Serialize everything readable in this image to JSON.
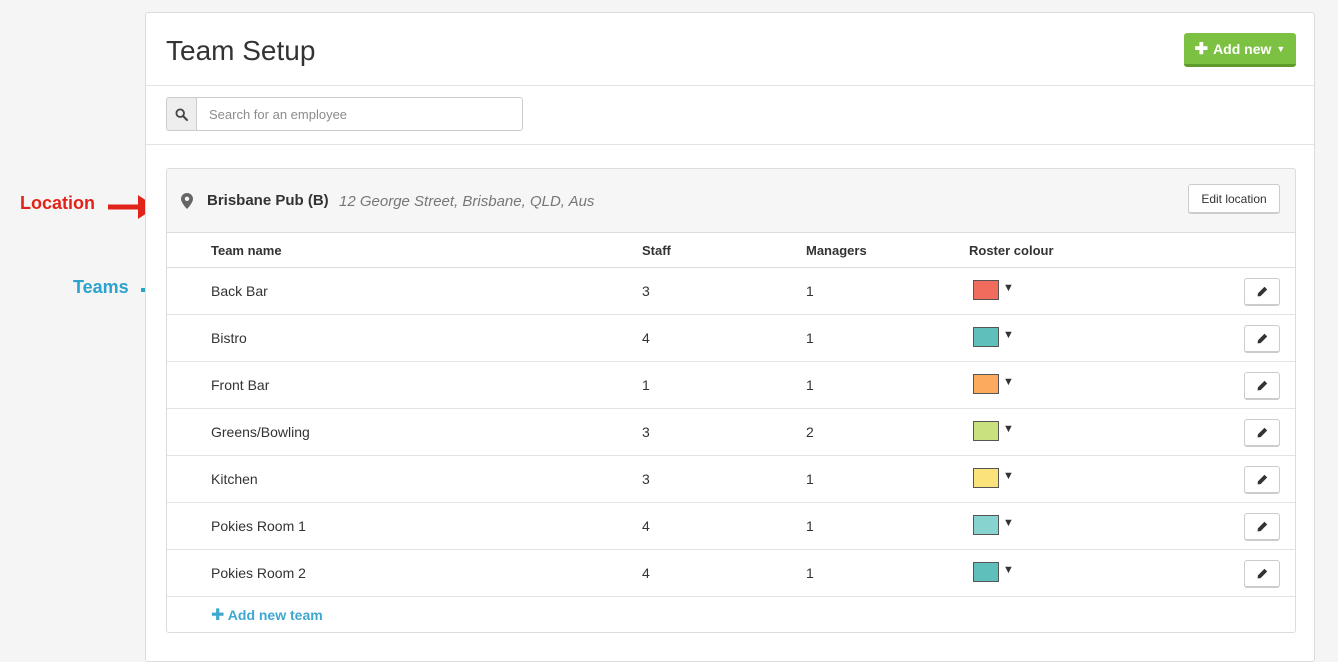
{
  "page": {
    "title": "Team Setup",
    "add_new_label": "Add new",
    "search_placeholder": "Search for an employee"
  },
  "location": {
    "name": "Brisbane Pub (B)",
    "address": "12 George Street, Brisbane, QLD, Aus",
    "edit_label": "Edit location"
  },
  "columns": {
    "team_name": "Team name",
    "staff": "Staff",
    "managers": "Managers",
    "roster_colour": "Roster colour"
  },
  "teams": [
    {
      "name": "Back Bar",
      "staff": "3",
      "managers": "1",
      "colour": "#f26c5d"
    },
    {
      "name": "Bistro",
      "staff": "4",
      "managers": "1",
      "colour": "#5fbfbb"
    },
    {
      "name": "Front Bar",
      "staff": "1",
      "managers": "1",
      "colour": "#fbaa5e"
    },
    {
      "name": "Greens/Bowling",
      "staff": "3",
      "managers": "2",
      "colour": "#c9e27f"
    },
    {
      "name": "Kitchen",
      "staff": "3",
      "managers": "1",
      "colour": "#fbe27a"
    },
    {
      "name": "Pokies Room 1",
      "staff": "4",
      "managers": "1",
      "colour": "#86d3cf"
    },
    {
      "name": "Pokies Room 2",
      "staff": "4",
      "managers": "1",
      "colour": "#5fbfbb"
    }
  ],
  "add_team_label": "Add new team",
  "annotations": {
    "location": "Location",
    "teams": "Teams",
    "location_color": "#e2231a",
    "teams_color": "#2ba3cc"
  },
  "icons": {
    "search": "search-icon",
    "location": "map-pin-icon",
    "edit": "pencil-icon",
    "plus": "plus-icon",
    "caret": "caret-down-icon"
  }
}
